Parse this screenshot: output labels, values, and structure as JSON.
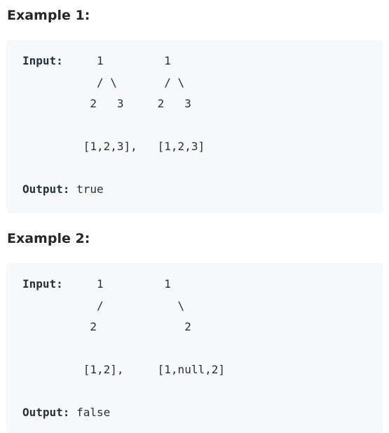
{
  "examples": [
    {
      "title": "Example 1:",
      "input_label": "Input:",
      "tree_lines": [
        "     1         1",
        "   / \\       / \\",
        "  2   3     2   3",
        "",
        " [1,2,3],   [1,2,3]"
      ],
      "output_label": "Output:",
      "output_value": "true"
    },
    {
      "title": "Example 2:",
      "input_label": "Input:",
      "tree_lines": [
        "     1         1",
        "   /           \\",
        "  2             2",
        "",
        " [1,2],     [1,null,2]"
      ],
      "output_label": "Output:",
      "output_value": "false"
    }
  ]
}
